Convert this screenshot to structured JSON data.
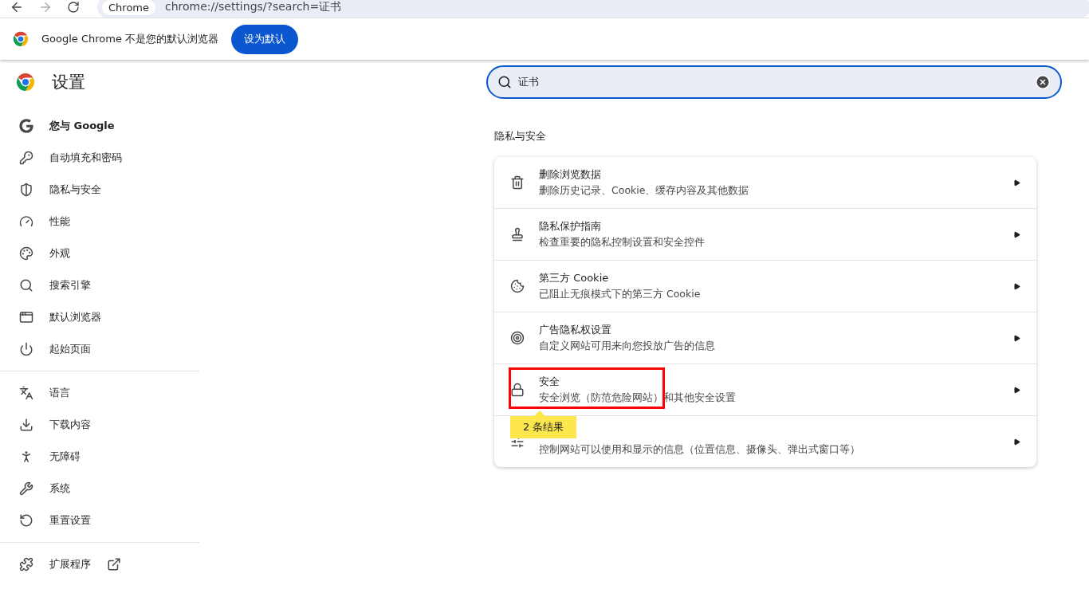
{
  "toolbar": {
    "chip": "Chrome",
    "url": "chrome://settings/?search=证书"
  },
  "banner": {
    "message": "Google Chrome 不是您的默认浏览器",
    "button": "设为默认"
  },
  "header": {
    "title": "设置"
  },
  "search": {
    "value": "证书"
  },
  "sidebar": {
    "groups": [
      [
        {
          "label": "您与 Google",
          "bold": true
        },
        {
          "label": "自动填充和密码",
          "bold": false
        },
        {
          "label": "隐私与安全",
          "bold": false
        },
        {
          "label": "性能",
          "bold": false
        },
        {
          "label": "外观",
          "bold": false
        },
        {
          "label": "搜索引擎",
          "bold": false
        },
        {
          "label": "默认浏览器",
          "bold": false
        },
        {
          "label": "起始页面",
          "bold": false
        }
      ],
      [
        {
          "label": "语言",
          "bold": false
        },
        {
          "label": "下载内容",
          "bold": false
        },
        {
          "label": "无障碍",
          "bold": false
        },
        {
          "label": "系统",
          "bold": false
        },
        {
          "label": "重置设置",
          "bold": false
        }
      ],
      [
        {
          "label": "扩展程序",
          "bold": false,
          "external": true
        }
      ]
    ]
  },
  "section": {
    "title": "隐私与安全",
    "rows": [
      {
        "title": "删除浏览数据",
        "subtitle": "删除历史记录、Cookie、缓存内容及其他数据",
        "highlighted": false
      },
      {
        "title": "隐私保护指南",
        "subtitle": "检查重要的隐私控制设置和安全控件",
        "highlighted": false
      },
      {
        "title": "第三方 Cookie",
        "subtitle": "已阻止无痕模式下的第三方 Cookie",
        "highlighted": false
      },
      {
        "title": "广告隐私权设置",
        "subtitle": "自定义网站可用来向您投放广告的信息",
        "highlighted": false
      },
      {
        "title": "安全",
        "subtitle": "安全浏览（防范危险网站）和其他安全设置",
        "highlighted": true,
        "bubble": "2 条结果"
      },
      {
        "subtitle": "控制网站可以使用和显示的信息（位置信息、摄像头、弹出式窗口等）",
        "highlighted": false
      }
    ]
  }
}
